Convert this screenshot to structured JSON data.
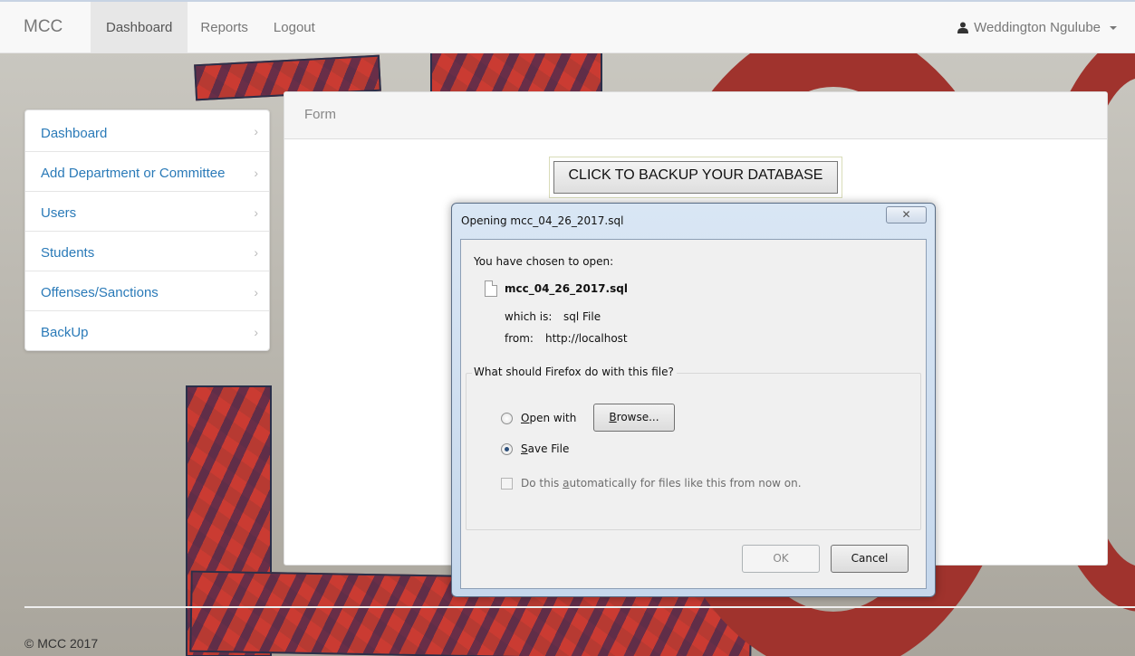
{
  "navbar": {
    "brand": "MCC",
    "items": [
      {
        "label": "Dashboard",
        "active": true
      },
      {
        "label": "Reports",
        "active": false
      },
      {
        "label": "Logout",
        "active": false
      }
    ],
    "user_name": "Weddington Ngulube",
    "user_icon": "user-icon"
  },
  "sidebar": {
    "items": [
      {
        "label": "Dashboard"
      },
      {
        "label": "Add Department or Committee"
      },
      {
        "label": "Users"
      },
      {
        "label": "Students"
      },
      {
        "label": "Offenses/Sanctions"
      },
      {
        "label": "BackUp"
      }
    ]
  },
  "panel": {
    "heading": "Form",
    "backup_button": "CLICK TO BACKUP YOUR DATABASE"
  },
  "dialog": {
    "title": "Opening mcc_04_26_2017.sql",
    "intro": "You have chosen to open:",
    "filename": "mcc_04_26_2017.sql",
    "type_label": "which is:",
    "type_value": "sql File",
    "from_label": "from:",
    "from_value": "http://localhost",
    "question": "What should Firefox do with this file?",
    "open_with_first": "O",
    "open_with_rest": "pen with",
    "browse_first": "B",
    "browse_rest": "rowse...",
    "save_first": "S",
    "save_rest": "ave File",
    "auto_pre": "Do this ",
    "auto_u": "a",
    "auto_post": "utomatically for files like this from now on.",
    "ok": "OK",
    "cancel": "Cancel",
    "selected_option": "Save File"
  },
  "footer": {
    "copyright": "© MCC 2017"
  }
}
